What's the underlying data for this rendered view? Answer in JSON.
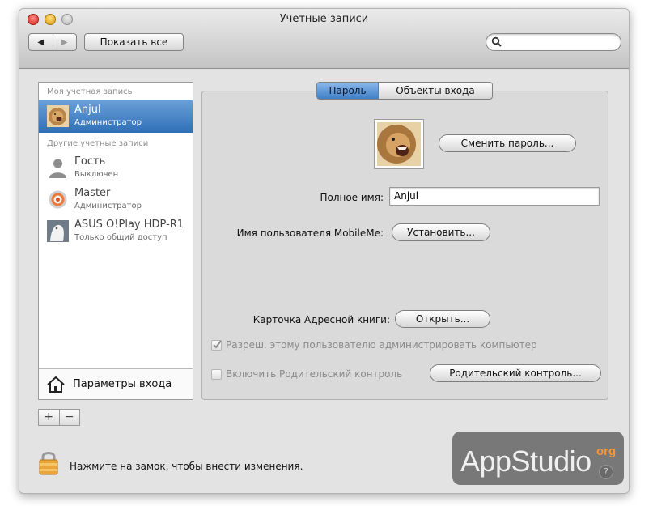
{
  "window": {
    "title": "Учетные записи"
  },
  "toolbar": {
    "back_glyph": "◀",
    "forward_glyph": "▶",
    "show_all_label": "Показать все",
    "search_placeholder": ""
  },
  "sidebar": {
    "my_account_header": "Моя учетная запись",
    "other_accounts_header": "Другие учетные записи",
    "accounts": [
      {
        "name": "Anjul",
        "role": "Администратор",
        "icon": "lion-avatar",
        "selected": true
      },
      {
        "name": "Гость",
        "role": "Выключен",
        "icon": "person-silhouette-icon",
        "selected": false
      },
      {
        "name": "Master",
        "role": "Администратор",
        "icon": "target-avatar",
        "selected": false
      },
      {
        "name": "ASUS O!Play HDP-R1",
        "role": "Только общий доступ",
        "icon": "shared-device-avatar",
        "selected": false
      }
    ],
    "login_options_label": "Параметры входа",
    "add_glyph": "+",
    "remove_glyph": "−"
  },
  "tabs": {
    "password": "Пароль",
    "login_items": "Объекты входа",
    "active": "password"
  },
  "details": {
    "change_password_label": "Сменить пароль...",
    "full_name_label": "Полное имя:",
    "full_name_value": "Anjul",
    "mobileme_label": "Имя пользователя MobileMe:",
    "mobileme_button": "Установить...",
    "address_card_label": "Карточка Адресной книги:",
    "address_card_button": "Открыть...",
    "allow_admin_label": "Разреш. этому пользователю администрировать компьютер",
    "allow_admin_checked": true,
    "parental_label": "Включить Родительский контроль",
    "parental_checked": false,
    "parental_button": "Родительский контроль..."
  },
  "footer": {
    "lock_text": "Нажмите на замок, чтобы внести изменения."
  },
  "watermark": {
    "main": "AppStudio",
    "suffix": "org",
    "help": "?"
  },
  "colors": {
    "selection": "#2f6fb7",
    "tab_active": "#5d96d6"
  }
}
